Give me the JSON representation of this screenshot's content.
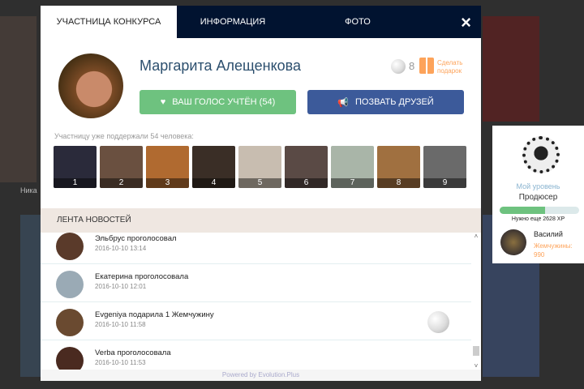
{
  "background": {
    "caption": "Ника"
  },
  "tabs": [
    {
      "label": "УЧАСТНИЦА КОНКУРСА"
    },
    {
      "label": "ИНФОРМАЦИЯ"
    },
    {
      "label": "ФОТО"
    }
  ],
  "close_icon": "×",
  "profile": {
    "name": "Маргарита Алещенкова",
    "pearls": "8",
    "gift_label_1": "Сделать",
    "gift_label_2": "подарок",
    "vote_button": "ВАШ ГОЛОС УЧТЁН (54)",
    "invite_button": "ПОЗВАТЬ ДРУЗЕЙ"
  },
  "supporters": {
    "label": "Участницу уже поддержали 54 человека:",
    "items": [
      {
        "n": "1",
        "c": "#2a2a3a"
      },
      {
        "n": "2",
        "c": "#6a5040"
      },
      {
        "n": "3",
        "c": "#b06a30"
      },
      {
        "n": "4",
        "c": "#3a2e26"
      },
      {
        "n": "5",
        "c": "#c8bdb0"
      },
      {
        "n": "6",
        "c": "#5a4a45"
      },
      {
        "n": "7",
        "c": "#a9b5a8"
      },
      {
        "n": "8",
        "c": "#a07040"
      },
      {
        "n": "9",
        "c": "#6a6a6a"
      }
    ]
  },
  "feed": {
    "title": "ЛЕНТА НОВОСТЕЙ",
    "items": [
      {
        "text": "Эльбрус проголосовал",
        "date": "2016-10-10 13:14",
        "c": "#5a3a2a",
        "pearl": false
      },
      {
        "text": "Екатерина проголосовала",
        "date": "2016-10-10 12:01",
        "c": "#9aaab5",
        "pearl": false
      },
      {
        "text": "Evgeniya подарила 1 Жемчужину",
        "date": "2016-10-10 11:58",
        "c": "#6a4a30",
        "pearl": true
      },
      {
        "text": "Verba проголосовала",
        "date": "2016-10-10 11:53",
        "c": "#4a2a20",
        "pearl": false
      }
    ]
  },
  "footer": "Powered by Evolution.Plus",
  "level": {
    "label": "Мой уровень",
    "rank": "Продюсер",
    "progress": 0.57,
    "need": "Нужно еще 2628 XP",
    "user": "Василий",
    "pearls_label": "Жемчужины:",
    "pearls": "990"
  }
}
